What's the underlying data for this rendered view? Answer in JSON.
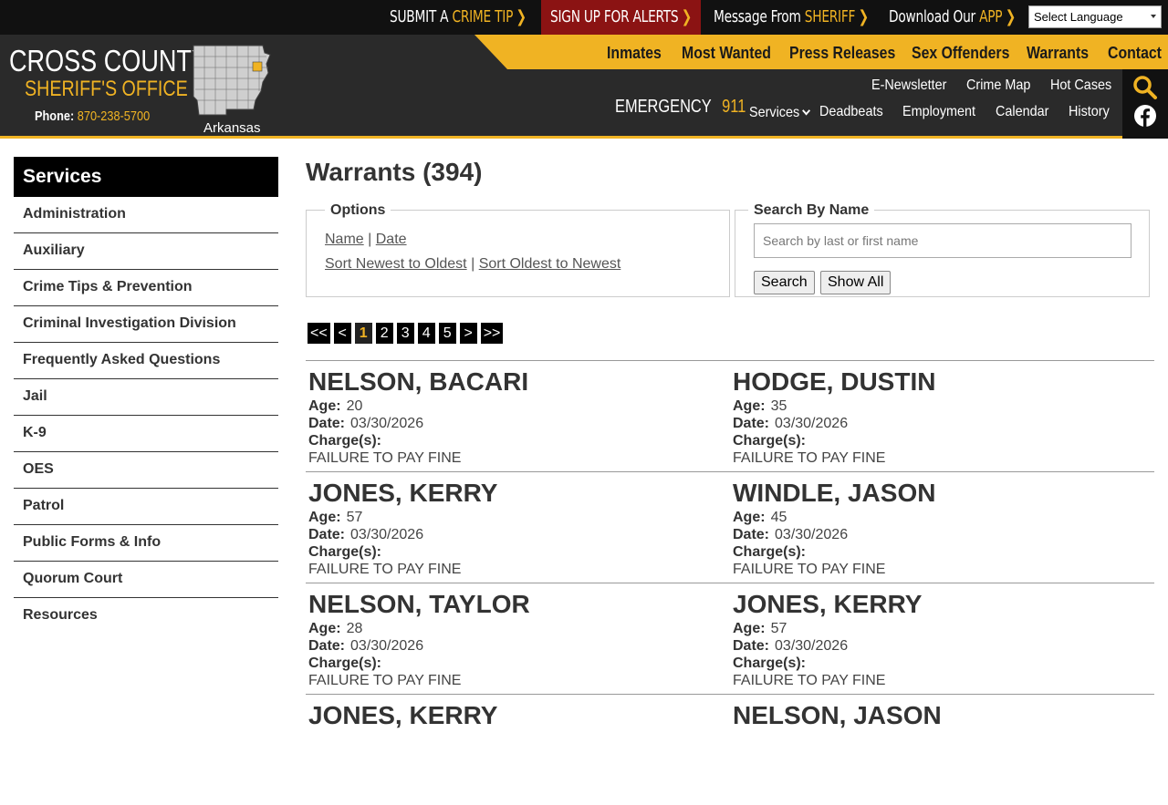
{
  "topbar": {
    "crime_tip_prefix": "SUBMIT A",
    "crime_tip_accent": "CRIME TIP",
    "alerts": "SIGN UP FOR ALERTS",
    "message_prefix": "Message From",
    "message_accent": "SHERIFF",
    "app_prefix": "Download Our",
    "app_accent": "APP",
    "language": "Select Language"
  },
  "brand": {
    "title": "CROSS COUNTY",
    "subtitle": "SHERIFF'S OFFICE",
    "phone_label": "Phone:",
    "phone_number": "870-238-5700",
    "state": "Arkansas"
  },
  "primary_nav": [
    "Inmates",
    "Most Wanted",
    "Press Releases",
    "Sex Offenders",
    "Warrants",
    "Contact"
  ],
  "emergency": {
    "label": "EMERGENCY",
    "number": "911"
  },
  "secondary_nav_top": [
    "E-Newsletter",
    "Crime Map",
    "Hot Cases"
  ],
  "secondary_nav_bottom": [
    "Services",
    "Deadbeats",
    "Employment",
    "Calendar",
    "History"
  ],
  "sidebar": {
    "heading": "Services",
    "items": [
      "Administration",
      "Auxiliary",
      "Crime Tips & Prevention",
      "Criminal Investigation Division",
      "Frequently Asked Questions",
      "Jail",
      "K-9",
      "OES",
      "Patrol",
      "Public Forms & Info",
      "Quorum Court",
      "Resources"
    ]
  },
  "main": {
    "title": "Warrants (394)",
    "options": {
      "legend": "Options",
      "sort_name": "Name",
      "sort_date": "Date",
      "sep": "|",
      "newest": "Sort Newest to Oldest",
      "oldest": "Sort Oldest to Newest"
    },
    "search": {
      "legend": "Search By Name",
      "placeholder": "Search by last or first name",
      "search_button": "Search",
      "show_all_button": "Show All"
    },
    "pager": [
      "<<",
      "<",
      "1",
      "2",
      "3",
      "4",
      "5",
      ">",
      ">>"
    ],
    "labels": {
      "age": "Age:",
      "date": "Date:",
      "charges": "Charge(s):"
    },
    "warrants": [
      {
        "name": "NELSON, BACARI",
        "age": "20",
        "date": "03/30/2026",
        "charge": "FAILURE TO PAY FINE"
      },
      {
        "name": "HODGE, DUSTIN",
        "age": "35",
        "date": "03/30/2026",
        "charge": "FAILURE TO PAY FINE"
      },
      {
        "name": "JONES, KERRY",
        "age": "57",
        "date": "03/30/2026",
        "charge": "FAILURE TO PAY FINE"
      },
      {
        "name": "WINDLE, JASON",
        "age": "45",
        "date": "03/30/2026",
        "charge": "FAILURE TO PAY FINE"
      },
      {
        "name": "NELSON, TAYLOR",
        "age": "28",
        "date": "03/30/2026",
        "charge": "FAILURE TO PAY FINE"
      },
      {
        "name": "JONES, KERRY",
        "age": "57",
        "date": "03/30/2026",
        "charge": "FAILURE TO PAY FINE"
      },
      {
        "name": "JONES, KERRY",
        "age": "",
        "date": "",
        "charge": ""
      },
      {
        "name": "NELSON, JASON",
        "age": "",
        "date": "",
        "charge": ""
      }
    ]
  },
  "colors": {
    "accent": "#f0b323",
    "alert": "#8b1313",
    "header": "#2a2a2a"
  }
}
